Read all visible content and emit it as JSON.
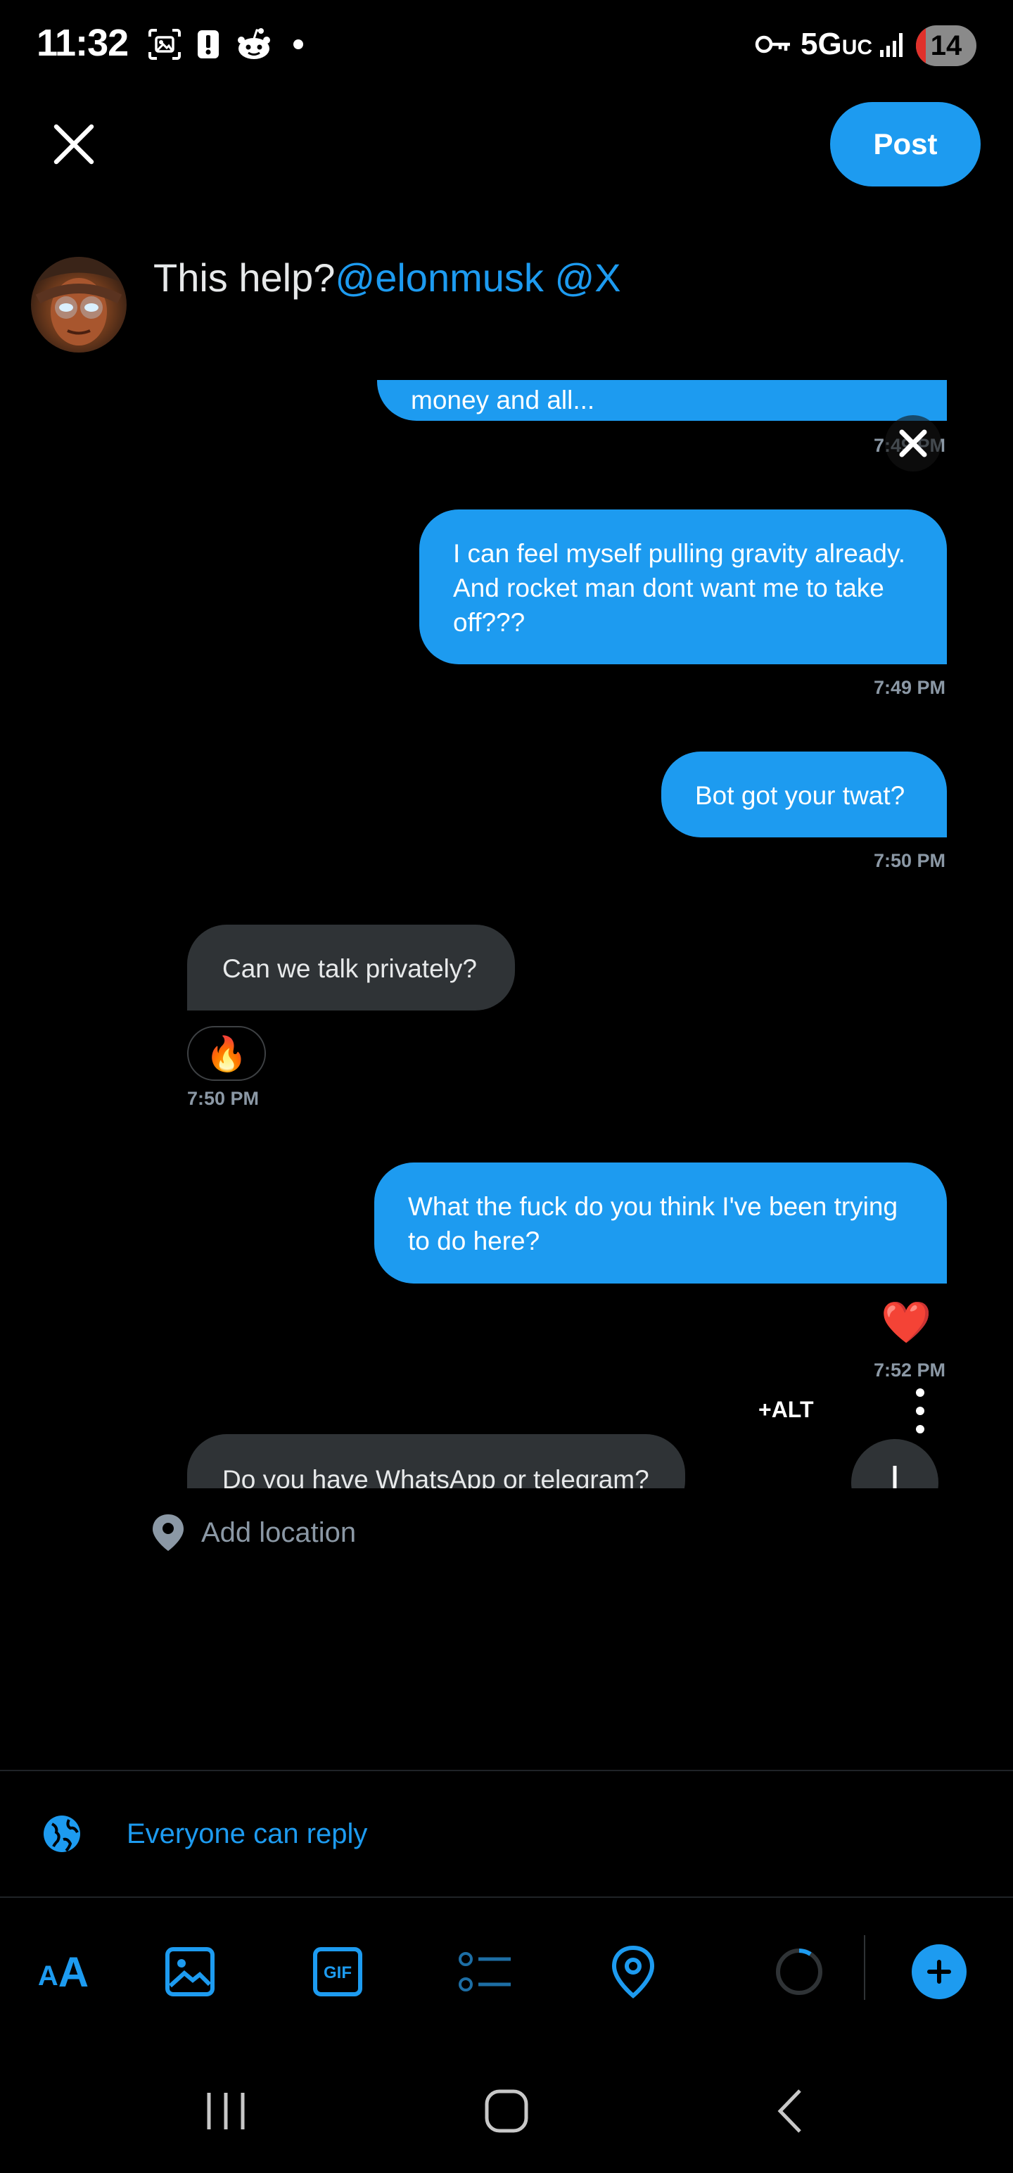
{
  "status_bar": {
    "time": "11:32",
    "network": "5G",
    "network_sub": "UC",
    "battery": "14",
    "icons": [
      "screenshot-icon",
      "alert-icon",
      "reddit-icon",
      "dot-icon",
      "vpn-key-icon",
      "signal-icon"
    ]
  },
  "header": {
    "close_icon": "close-icon",
    "post_label": "Post"
  },
  "compose": {
    "text": "This help?",
    "mentions": "@elonmusk @X"
  },
  "media": {
    "partial_top_text": "money and all...",
    "partial_top_time": "7:49 PM",
    "messages": [
      {
        "side": "out",
        "text": "I can feel myself pulling gravity already. And rocket man dont want me to take off???",
        "time": "7:49 PM"
      },
      {
        "side": "out",
        "text": "Bot got your twat?",
        "time": "7:50 PM"
      },
      {
        "side": "in",
        "text": "Can we talk privately?",
        "reaction": "🔥",
        "time": "7:50 PM"
      },
      {
        "side": "out",
        "text": "What the fuck do you think I've been trying to do here?",
        "reaction": "❤️",
        "time": "7:52 PM"
      },
      {
        "side": "in",
        "text": "Do you have WhatsApp or telegram?"
      }
    ],
    "alt_label": "+ALT"
  },
  "location": {
    "label": "Add location"
  },
  "reply_setting": {
    "label": "Everyone can reply"
  },
  "colors": {
    "accent": "#1d9bf0",
    "background": "#000000",
    "incoming_bubble": "#2f3336",
    "muted": "#8b98a5"
  }
}
